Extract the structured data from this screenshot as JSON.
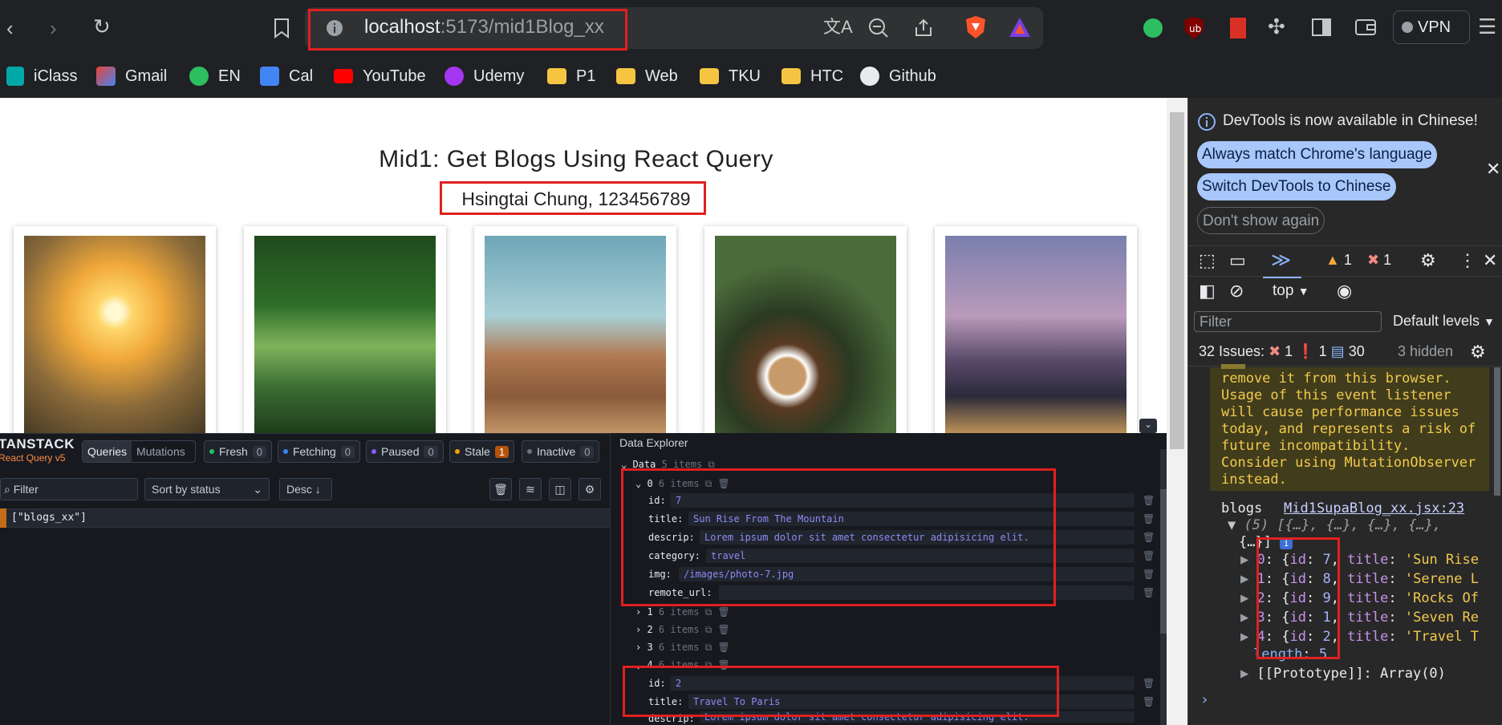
{
  "browser": {
    "url_host": "localhost",
    "url_rest": ":5173/mid1Blog_xx",
    "vpn_label": "VPN",
    "bookmarks": [
      {
        "label": "iClass",
        "icon": "iclass-icon"
      },
      {
        "label": "Gmail",
        "icon": "gmail-icon"
      },
      {
        "label": "EN",
        "icon": "evernote-icon"
      },
      {
        "label": "Cal",
        "icon": "calendar-icon"
      },
      {
        "label": "YouTube",
        "icon": "youtube-icon"
      },
      {
        "label": "Udemy",
        "icon": "udemy-icon"
      },
      {
        "label": "P1",
        "icon": "folder-icon"
      },
      {
        "label": "Web",
        "icon": "folder-icon"
      },
      {
        "label": "TKU",
        "icon": "folder-icon"
      },
      {
        "label": "HTC",
        "icon": "folder-icon"
      },
      {
        "label": "Github",
        "icon": "github-icon"
      }
    ]
  },
  "page": {
    "title": "Mid1: Get Blogs Using React Query",
    "subtitle": "Hsingtai Chung, 123456789",
    "cards": [
      {
        "photo": "sunrise-mountain-photo"
      },
      {
        "photo": "forest-river-photo"
      },
      {
        "photo": "rocks-sky-photo"
      },
      {
        "photo": "coffee-cups-photo"
      },
      {
        "photo": "paris-bridge-photo"
      }
    ]
  },
  "tanstack": {
    "logo_top": "TANSTACK",
    "logo_bottom": "React Query v5",
    "tab_queries": "Queries",
    "tab_mutations": "Mutations",
    "statuses": [
      {
        "label": "Fresh",
        "count": "0",
        "color": "#22c55e"
      },
      {
        "label": "Fetching",
        "count": "0",
        "color": "#3b82f6"
      },
      {
        "label": "Paused",
        "count": "0",
        "color": "#8b5cf6"
      },
      {
        "label": "Stale",
        "count": "1",
        "color": "#f59e0b"
      },
      {
        "label": "Inactive",
        "count": "0",
        "color": "#6b7280"
      }
    ],
    "filter_placeholder": "Filter",
    "sort_label": "Sort by status",
    "order_label": "Desc ↓",
    "query_key": "[\"blogs_xx\"]"
  },
  "explorer": {
    "title": "Data Explorer",
    "root_label": "Data",
    "root_meta": "5 items",
    "item_meta": "6 items",
    "item0": {
      "index": "0",
      "fields": [
        {
          "key": "id:",
          "value": "7"
        },
        {
          "key": "title:",
          "value": "Sun Rise From The Mountain"
        },
        {
          "key": "descrip:",
          "value": "Lorem ipsum dolor sit amet consectetur adipisicing elit."
        },
        {
          "key": "category:",
          "value": "travel"
        },
        {
          "key": "img:",
          "value": "/images/photo-7.jpg"
        },
        {
          "key": "remote_url:",
          "value": ""
        }
      ]
    },
    "collapsed": [
      "1",
      "2",
      "3"
    ],
    "item4": {
      "index": "4",
      "fields": [
        {
          "key": "id:",
          "value": "2"
        },
        {
          "key": "title:",
          "value": "Travel To Paris"
        },
        {
          "key": "descrip:",
          "value": "Lorem ipsum dolor sit amet consectetur adipisicing elit."
        }
      ]
    }
  },
  "devtools": {
    "banner": "DevTools is now available in Chinese!",
    "btn_match": "Always match Chrome's language",
    "btn_switch": "Switch DevTools to Chinese",
    "btn_dont": "Don't show again",
    "warn_count": "1",
    "error_count": "1",
    "context": "top",
    "filter_placeholder": "Filter",
    "levels": "Default levels",
    "issues_label": "32 Issues:",
    "issues_err": "1",
    "issues_warn": "1",
    "issues_info": "30",
    "issues_hidden": "3 hidden",
    "warning_lines": [
      "remove it from this browser.",
      "Usage of this event listener",
      "will cause performance issues",
      "today, and represents a risk of",
      "future incompatibility.",
      "Consider using MutationObserver",
      "instead."
    ],
    "log_label": "blogs",
    "log_source": "Mid1SupaBlog_xx.jsx:23",
    "array_summary": "(5) [{…}, {…}, {…}, {…},",
    "array_summary2": "{…}]",
    "entries": [
      {
        "idx": "0",
        "id": "7",
        "title": "'Sun Rise"
      },
      {
        "idx": "1",
        "id": "8",
        "title": "'Serene L"
      },
      {
        "idx": "2",
        "id": "9",
        "title": "'Rocks Of"
      },
      {
        "idx": "3",
        "id": "1",
        "title": "'Seven Re"
      },
      {
        "idx": "4",
        "id": "2",
        "title": "'Travel T"
      }
    ],
    "length_key": "length",
    "length_val": "5",
    "prototype": "[[Prototype]]: Array(0)"
  }
}
